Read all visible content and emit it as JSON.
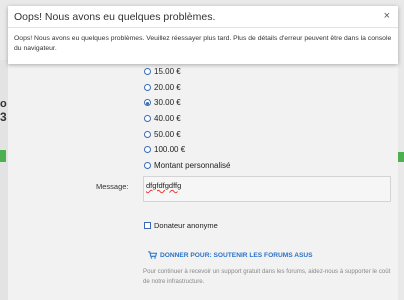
{
  "modal": {
    "title": "Oops! Nous avons eu quelques problèmes.",
    "close_label": "×",
    "message": "Oops! Nous avons eu quelques problèmes. Veuillez réessayer plus tard. Plus de détails d'erreur peuvent être dans la console du navigateur."
  },
  "background": {
    "side_glyph_1": "o",
    "side_glyph_2": "3"
  },
  "donation": {
    "amounts": [
      {
        "label": "15.00 €",
        "checked": false
      },
      {
        "label": "20.00 €",
        "checked": false
      },
      {
        "label": "30.00 €",
        "checked": true
      },
      {
        "label": "40.00 €",
        "checked": false
      },
      {
        "label": "50.00 €",
        "checked": false
      },
      {
        "label": "100.00 €",
        "checked": false
      },
      {
        "label": "Montant personnalisé",
        "checked": false
      }
    ],
    "message_label": "Message:",
    "message_value": "dfgfdfgdffg",
    "anonymous_label": "Donateur anonyme",
    "donate_link": "DONNER POUR: SOUTENIR LES FORUMS ASUS",
    "info_text": "Pour continuer à recevoir un support gratuit dans les forums, aidez-nous à supporter le coût de notre infrastructure."
  },
  "colors": {
    "accent": "#2a73c8",
    "radio": "#3b6bb5",
    "green": "#4caf50"
  }
}
